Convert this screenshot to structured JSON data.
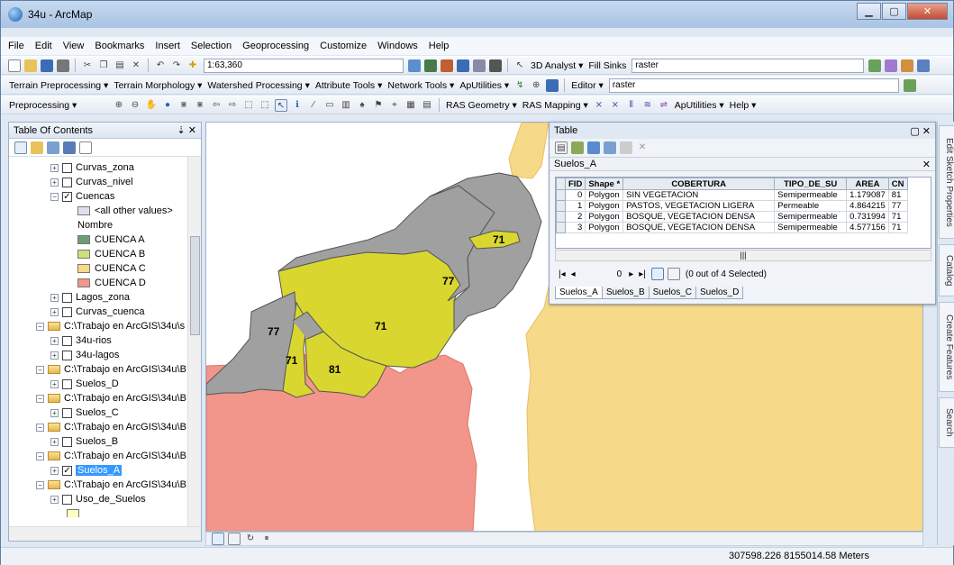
{
  "window": {
    "title": "34u - ArcMap"
  },
  "menu": [
    "File",
    "Edit",
    "View",
    "Bookmarks",
    "Insert",
    "Selection",
    "Geoprocessing",
    "Customize",
    "Windows",
    "Help"
  ],
  "toolbar1": {
    "scale": "1:63,360",
    "analyst": "3D Analyst ▾",
    "fill_sinks": "Fill Sinks",
    "layer": "raster"
  },
  "toolbar2": {
    "items": [
      "Terrain Preprocessing ▾",
      "Terrain Morphology ▾",
      "Watershed Processing ▾",
      "Attribute Tools ▾",
      "Network Tools ▾",
      "ApUtilities ▾"
    ],
    "editor": "Editor ▾",
    "layer": "raster"
  },
  "toolbar3": {
    "preprocessing": "Preprocessing ▾",
    "ras_geometry": "RAS Geometry ▾",
    "ras_mapping": "RAS Mapping ▾",
    "aputilities": "ApUtilities ▾",
    "help": "Help ▾"
  },
  "toc": {
    "title": "Table Of Contents",
    "rows": [
      {
        "label": "Curvas_zona",
        "type": "layer",
        "checked": false
      },
      {
        "label": "Curvas_nivel",
        "type": "layer",
        "checked": false
      },
      {
        "label": "Cuencas",
        "type": "layer",
        "checked": true
      },
      {
        "label": "<all other values>",
        "type": "legend",
        "color": "#e6dcf2"
      },
      {
        "label": "Nombre",
        "type": "heading"
      },
      {
        "label": "CUENCA A",
        "type": "legend",
        "color": "#6a9e73"
      },
      {
        "label": "CUENCA B",
        "type": "legend",
        "color": "#cde07a"
      },
      {
        "label": "CUENCA C",
        "type": "legend",
        "color": "#f7d98a"
      },
      {
        "label": "CUENCA D",
        "type": "legend",
        "color": "#f2958a"
      },
      {
        "label": "Lagos_zona",
        "type": "layer",
        "checked": false
      },
      {
        "label": "Curvas_cuenca",
        "type": "layer",
        "checked": false
      },
      {
        "label": "C:\\Trabajo en ArcGIS\\34u\\s",
        "type": "folder"
      },
      {
        "label": "34u-rios",
        "type": "layer",
        "checked": false
      },
      {
        "label": "34u-lagos",
        "type": "layer",
        "checked": false
      },
      {
        "label": "C:\\Trabajo en ArcGIS\\34u\\B",
        "type": "folder"
      },
      {
        "label": "Suelos_D",
        "type": "layer",
        "checked": false
      },
      {
        "label": "C:\\Trabajo en ArcGIS\\34u\\B",
        "type": "folder"
      },
      {
        "label": "Suelos_C",
        "type": "layer",
        "checked": false
      },
      {
        "label": "C:\\Trabajo en ArcGIS\\34u\\B",
        "type": "folder"
      },
      {
        "label": "Suelos_B",
        "type": "layer",
        "checked": false
      },
      {
        "label": "C:\\Trabajo en ArcGIS\\34u\\B",
        "type": "folder"
      },
      {
        "label": "Suelos_A",
        "type": "layer",
        "checked": true,
        "selected": true
      },
      {
        "label": "C:\\Trabajo en ArcGIS\\34u\\B",
        "type": "folder"
      },
      {
        "label": "Uso_de_Suelos",
        "type": "layer",
        "checked": false
      },
      {
        "label": "",
        "type": "legend",
        "color": "#ffffc0"
      }
    ]
  },
  "map": {
    "labels": [
      {
        "text": "71"
      },
      {
        "text": "77"
      },
      {
        "text": "71"
      },
      {
        "text": "77"
      },
      {
        "text": "71"
      },
      {
        "text": "81"
      }
    ]
  },
  "table": {
    "title": "Table",
    "layer": "Suelos_A",
    "columns": [
      "FID",
      "Shape *",
      "COBERTURA",
      "TIPO_DE_SU",
      "AREA",
      "CN"
    ],
    "rows": [
      [
        "0",
        "Polygon",
        "SIN VEGETACION",
        "Semipermeable",
        "1.179087",
        "81"
      ],
      [
        "1",
        "Polygon",
        "PASTOS, VEGETACION LIGERA",
        "Permeable",
        "4.864215",
        "77"
      ],
      [
        "2",
        "Polygon",
        "BOSQUE, VEGETACION DENSA",
        "Semipermeable",
        "0.731994",
        "71"
      ],
      [
        "3",
        "Polygon",
        "BOSQUE, VEGETACION DENSA",
        "Semipermeable",
        "4.577156",
        "71"
      ]
    ],
    "record": "0",
    "selection": "(0 out of 4 Selected)",
    "tabs": [
      "Suelos_A",
      "Suelos_B",
      "Suelos_C",
      "Suelos_D"
    ]
  },
  "dock_tabs": [
    "Edit Sketch Properties",
    "Catalog",
    "Create Features",
    "Search"
  ],
  "status": {
    "coords": "307598.226  8155014.58 Meters"
  }
}
